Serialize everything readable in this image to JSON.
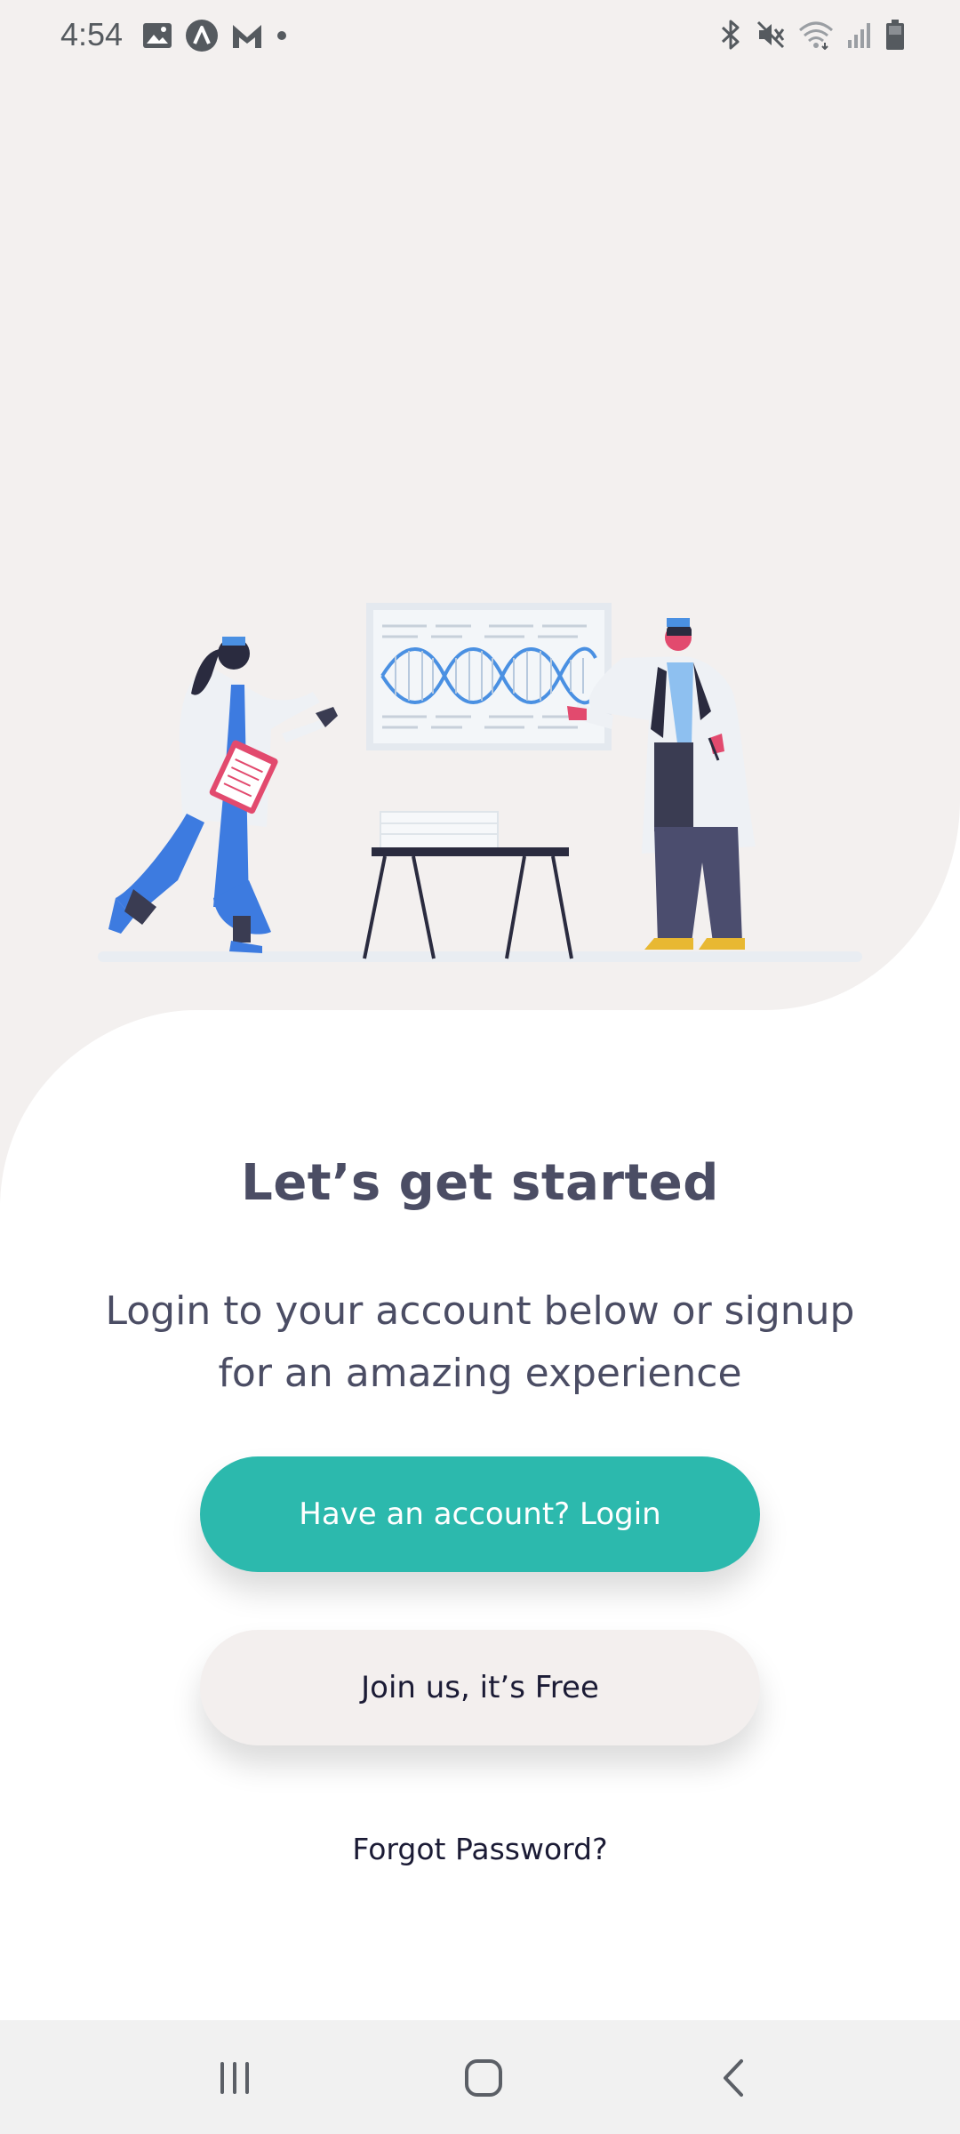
{
  "status_bar": {
    "time": "4:54",
    "left_icons": [
      "gallery-icon",
      "app-a-icon",
      "app-m-icon",
      "notification-dot-icon"
    ],
    "right_icons": [
      "bluetooth-icon",
      "mute-icon",
      "wifi-icon",
      "signal-icon",
      "battery-icon"
    ]
  },
  "onboarding": {
    "title": "Let’s get started",
    "subtitle": "Login to your account below or signup for an amazing experience",
    "login_button": "Have an account? Login",
    "signup_button": "Join us, it’s Free",
    "forgot_password": "Forgot Password?"
  },
  "nav_bar": {
    "buttons": [
      "recent-apps-icon",
      "home-icon",
      "back-icon"
    ]
  },
  "colors": {
    "hero_background": "#f3f0ef",
    "primary_teal": "#2cb9ad",
    "text_dark": "#4b4d64",
    "button_light": "#f3efee",
    "nav_background": "#f1f1f1"
  }
}
